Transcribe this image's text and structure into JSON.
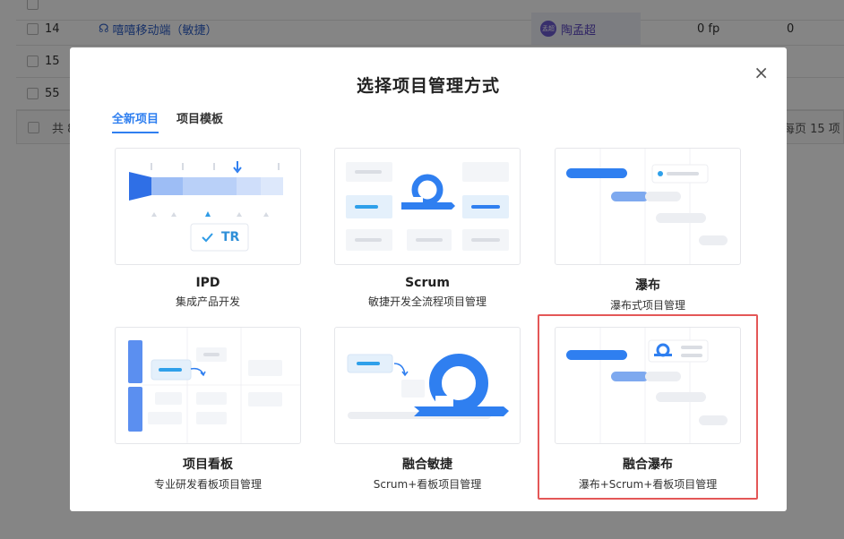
{
  "background_table": {
    "rows": [
      {
        "id": "14",
        "title": "嘻嘻移动端（敏捷）",
        "assignee": "陶孟超",
        "avatar_text": "孟超",
        "fp": "0 fp",
        "count": "0"
      },
      {
        "id": "15"
      },
      {
        "id": "55"
      }
    ],
    "footer_total": "共 8",
    "footer_per_page": "每页 15 项"
  },
  "modal": {
    "title": "选择项目管理方式",
    "close_symbol": "×",
    "tabs": [
      {
        "label": "全新项目",
        "active": true
      },
      {
        "label": "项目模板",
        "active": false
      }
    ],
    "cards": [
      {
        "name": "IPD",
        "desc": "集成产品开发",
        "thumb_text": "TR"
      },
      {
        "name": "Scrum",
        "desc": "敏捷开发全流程项目管理"
      },
      {
        "name": "瀑布",
        "desc": "瀑布式项目管理"
      },
      {
        "name": "项目看板",
        "desc": "专业研发看板项目管理"
      },
      {
        "name": "融合敏捷",
        "desc": "Scrum+看板项目管理"
      },
      {
        "name": "融合瀑布",
        "desc": "瀑布+Scrum+看板项目管理",
        "highlighted": true
      }
    ]
  },
  "colors": {
    "accent": "#2f7ff0",
    "highlight_border": "#e45757"
  }
}
